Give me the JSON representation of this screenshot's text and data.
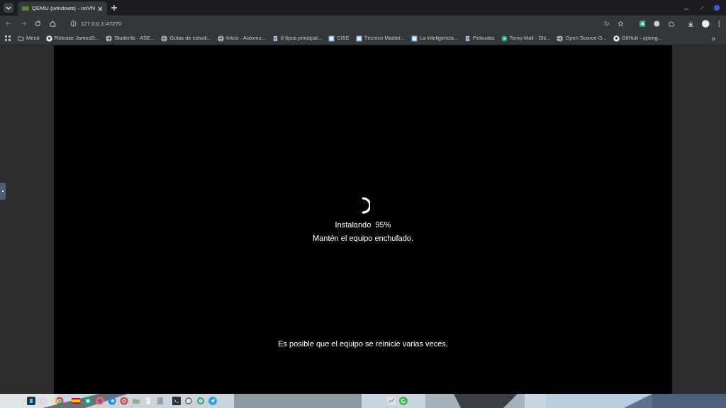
{
  "tab": {
    "title": "QEMU (windows) - noVN",
    "selected": true
  },
  "address_bar": {
    "url": "127.0.0.1:47270"
  },
  "bookmarks": [
    {
      "label": "Menú",
      "kind": "folder"
    },
    {
      "label": "Release JamesD...",
      "kind": "github"
    },
    {
      "label": "Students - ASE...",
      "kind": "globe"
    },
    {
      "label": "Guías de estudi...",
      "kind": "globe"
    },
    {
      "label": "Inicio - Automo...",
      "kind": "globe"
    },
    {
      "label": "8 tipos principal...",
      "kind": "page"
    },
    {
      "label": "CISE",
      "kind": "app"
    },
    {
      "label": "Técnico Master...",
      "kind": "app"
    },
    {
      "label": "La inteligencia...",
      "kind": "app"
    },
    {
      "label": "Películas",
      "kind": "page"
    },
    {
      "label": "Temp Mail - Dis...",
      "kind": "mail"
    },
    {
      "label": "Open Source G...",
      "kind": "globe"
    },
    {
      "label": "GitHub - openg...",
      "kind": "github"
    }
  ],
  "bookmarks_overflow": "»",
  "vm_screen": {
    "status": "Instalando  95%",
    "message": "Mantén el equipo enchufado.",
    "note": "Es posible que el equipo se reinicie varias veces."
  }
}
